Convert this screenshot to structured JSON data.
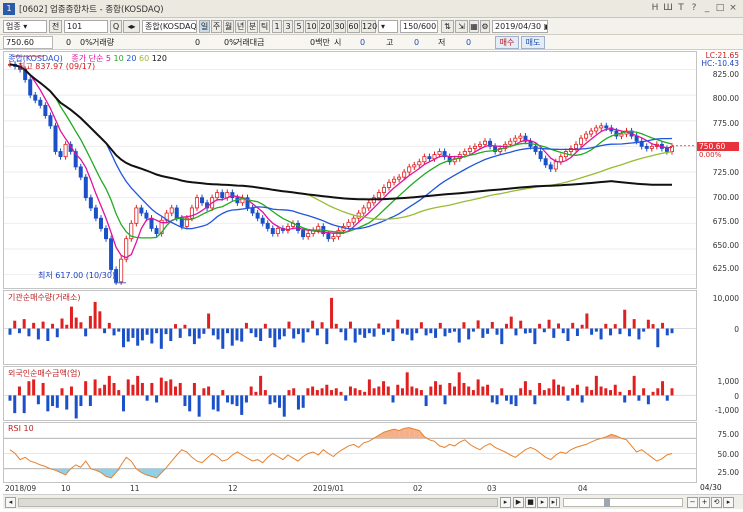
{
  "window": {
    "title": "[0602] 업종종합차트 - 종합(KOSDAQ)",
    "badge": "1",
    "controls": [
      "H",
      "Ш",
      "T",
      "?",
      "_",
      "□",
      "×"
    ]
  },
  "toolbar": {
    "market": "업종",
    "type_btn": "전",
    "code": "101",
    "search_btn": "Q",
    "name": "종합(KOSDAQ)",
    "periods": [
      "일",
      "주",
      "월",
      "년",
      "분",
      "틱"
    ],
    "selected_period": "일",
    "minutes": [
      "1",
      "3",
      "5",
      "10",
      "20",
      "30",
      "60",
      "120"
    ],
    "count": "150/600",
    "date": "2019/04/30"
  },
  "infobar": {
    "price": "750.60",
    "change": "0",
    "change_pct": "0%",
    "volume_label": "거래량",
    "volume": "0",
    "value_pct": "0%",
    "value_label": "거래대금",
    "value": "0백만",
    "open_label": "시",
    "open": "0",
    "high_label": "고",
    "high": "0",
    "low_label": "저",
    "low": "0",
    "buy_btn": "매수",
    "sell_btn": "매도"
  },
  "price_panel": {
    "label": "종합(KOSDAQ)",
    "ma_label": "종가 단순",
    "ma_periods": [
      "5",
      "10",
      "20",
      "60",
      "120"
    ],
    "ma_colors": [
      "#e0119e",
      "#22aa22",
      "#2255dd",
      "#99bb33",
      "#111111"
    ],
    "max_note": "최고 837.97 (09/17)",
    "min_note": "최저 617.00 (10/30)",
    "lc": "LC:21.65",
    "hc": "HC:-10.43",
    "current": "750.60",
    "current_pct": "0.00%",
    "y_ticks": [
      "825.00",
      "800.00",
      "775.00",
      "750.00",
      "725.00",
      "700.00",
      "675.00",
      "650.00",
      "625.00"
    ]
  },
  "inst_panel": {
    "label": "기관순매수량(거래소)",
    "y_ticks": [
      "10,000",
      "0"
    ]
  },
  "foreign_panel": {
    "label": "외국인순매수금액(업)",
    "y_ticks": [
      "1,000",
      "0",
      "-1,000"
    ]
  },
  "rsi_panel": {
    "label": "RSI 10",
    "y_ticks": [
      "75.00",
      "50.00",
      "25.00"
    ]
  },
  "x_axis": {
    "labels": [
      "2018/09",
      "10",
      "11",
      "12",
      "2019/01",
      "02",
      "03",
      "04"
    ],
    "right_label": "04/30"
  },
  "chart_data": [
    {
      "type": "line",
      "title": "종합(KOSDAQ)",
      "series_note": "Daily candlestick KOSDAQ composite with simple moving averages 5/10/20/60/120",
      "x": [
        "2018/09",
        "10",
        "11",
        "12",
        "2019/01",
        "02",
        "03",
        "04"
      ],
      "close": [
        830,
        828,
        825,
        815,
        800,
        795,
        790,
        780,
        770,
        745,
        740,
        752,
        745,
        730,
        720,
        700,
        690,
        680,
        670,
        660,
        630,
        618,
        640,
        660,
        675,
        690,
        685,
        680,
        670,
        665,
        678,
        685,
        690,
        680,
        672,
        680,
        690,
        700,
        695,
        690,
        700,
        705,
        700,
        705,
        700,
        695,
        700,
        690,
        685,
        680,
        675,
        670,
        665,
        670,
        668,
        672,
        675,
        668,
        662,
        665,
        668,
        672,
        665,
        660,
        662,
        668,
        672,
        676,
        680,
        685,
        690,
        695,
        700,
        705,
        710,
        715,
        718,
        720,
        725,
        730,
        732,
        735,
        740,
        738,
        742,
        745,
        740,
        735,
        738,
        742,
        745,
        748,
        750,
        752,
        755,
        750,
        745,
        748,
        752,
        755,
        758,
        760,
        755,
        750,
        745,
        738,
        732,
        728,
        735,
        740,
        745,
        748,
        752,
        758,
        762,
        765,
        768,
        770,
        768,
        765,
        760,
        762,
        765,
        760,
        755,
        750,
        748,
        750,
        752,
        748,
        745,
        750
      ],
      "ylim": [
        610,
        842
      ],
      "max": 837.97,
      "min": 617.0,
      "last": 750.6
    },
    {
      "type": "bar",
      "title": "기관순매수량(거래소)",
      "values": [
        -2000,
        2500,
        -1500,
        3000,
        -2500,
        1800,
        -3500,
        2200,
        -4000,
        1500,
        -2800,
        3200,
        1200,
        7000,
        3500,
        2000,
        -2500,
        4000,
        8500,
        5500,
        -1500,
        1800,
        -2200,
        -1000,
        -6000,
        -4200,
        -3000,
        -5500,
        -3800,
        -2000,
        -4800,
        -1500,
        -6500,
        -1800,
        -4000,
        1400,
        -3000,
        1200,
        -2500,
        -5000,
        -3200,
        -1700,
        4800,
        -2200,
        -3500,
        -6500,
        -1500,
        -5500,
        -3800,
        -4200,
        1800,
        -1500,
        -2800,
        -4000,
        1500,
        -3000,
        -6000,
        -3500,
        -2500,
        2200,
        -3200,
        -1800,
        -4500,
        -1200,
        2500,
        -2200,
        2000,
        -5000,
        9800,
        1500,
        -1200,
        -3800,
        2200,
        -4500,
        -2000,
        -3000,
        -1500,
        -2600,
        1600,
        -2000,
        -1200,
        -4000,
        2800,
        -1600,
        -2000,
        -3800,
        -1500,
        2000,
        -2200,
        -1500,
        -3000,
        1800,
        -2500,
        -1400,
        -1000,
        -4500,
        2000,
        -3500,
        -1000,
        2600,
        -3000,
        -1700,
        2100,
        -2000,
        -5000,
        1500,
        3800,
        -2200,
        2500,
        -1600,
        -1400,
        -5000,
        1500,
        -1200,
        2800,
        -3000,
        1600,
        -1500,
        -4000,
        1800,
        -2400,
        1200,
        4800,
        -2000,
        -1000,
        -3500,
        1500,
        -2200,
        1400,
        -1800,
        6000,
        -2500,
        3000,
        -3500,
        -1000,
        2800,
        1400,
        -6000,
        1800,
        -2200,
        -1500
      ],
      "ylim": [
        -12000,
        12000
      ]
    },
    {
      "type": "bar",
      "title": "외국인순매수금액(업)",
      "values": [
        -300,
        -1000,
        500,
        -1000,
        800,
        900,
        -500,
        700,
        -900,
        -600,
        -700,
        400,
        -800,
        500,
        -1300,
        -600,
        800,
        -600,
        900,
        400,
        600,
        1100,
        700,
        300,
        -900,
        900,
        600,
        1100,
        700,
        -300,
        700,
        -400,
        1000,
        800,
        900,
        500,
        700,
        -600,
        -900,
        700,
        -1200,
        400,
        500,
        -800,
        -900,
        300,
        -400,
        -500,
        -600,
        -1100,
        -400,
        500,
        200,
        1100,
        300,
        -500,
        -400,
        -700,
        -1200,
        300,
        400,
        -800,
        -700,
        400,
        500,
        300,
        400,
        600,
        300,
        400,
        200,
        -300,
        500,
        400,
        300,
        200,
        900,
        400,
        500,
        800,
        500,
        -400,
        600,
        400,
        1300,
        500,
        400,
        300,
        -600,
        500,
        800,
        600,
        -500,
        700,
        500,
        1300,
        700,
        500,
        300,
        900,
        500,
        600,
        -400,
        -500,
        400,
        -300,
        -500,
        -600,
        400,
        800,
        300,
        -500,
        700,
        300,
        400,
        900,
        600,
        500,
        -300,
        400,
        600,
        -400,
        500,
        300,
        1100,
        500,
        400,
        300,
        600,
        200,
        -400,
        300,
        1100,
        -300,
        400,
        -500,
        200,
        400,
        800,
        -300,
        400
      ],
      "ylim": [
        -1500,
        1600
      ]
    },
    {
      "type": "line",
      "title": "RSI 10",
      "values": [
        55,
        50,
        42,
        45,
        40,
        38,
        35,
        33,
        30,
        28,
        25,
        22,
        30,
        35,
        32,
        40,
        30,
        28,
        25,
        20,
        18,
        25,
        35,
        45,
        40,
        30,
        25,
        22,
        20,
        18,
        25,
        32,
        40,
        48,
        55,
        52,
        45,
        40,
        38,
        44,
        50,
        46,
        40,
        42,
        48,
        52,
        48,
        44,
        40,
        42,
        38,
        45,
        50,
        46,
        42,
        48,
        44,
        40,
        46,
        50,
        52,
        48,
        55,
        50,
        46,
        52,
        56,
        60,
        62,
        58,
        64,
        66,
        70,
        74,
        78,
        80,
        82,
        80,
        83,
        84,
        82,
        80,
        72,
        68,
        66,
        60,
        58,
        62,
        60,
        65,
        68,
        62,
        58,
        55,
        60,
        63,
        58,
        55,
        52,
        48,
        45,
        50,
        55,
        58,
        55,
        50,
        45,
        42,
        48,
        52,
        50,
        55,
        58,
        60,
        62,
        65,
        68,
        70,
        72,
        75,
        73,
        70,
        68,
        60,
        52,
        55,
        50,
        45,
        40,
        43,
        48,
        50
      ],
      "ylim": [
        10,
        90
      ],
      "bands": [
        30,
        70
      ]
    }
  ]
}
